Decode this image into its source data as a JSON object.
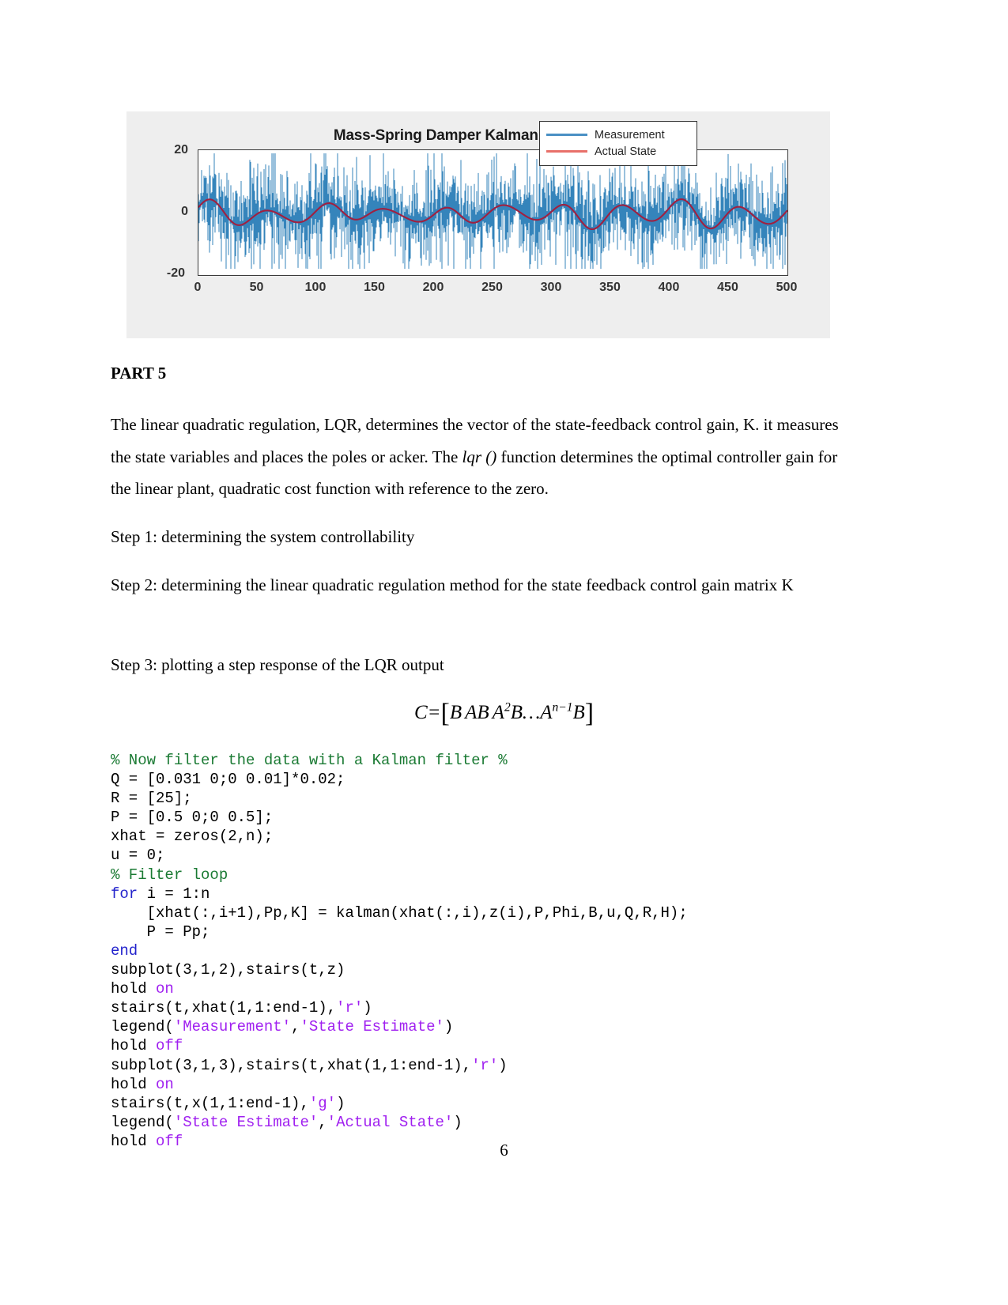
{
  "figure": {
    "title": "Mass-Spring Damper Kalman Filter Demo",
    "legend": [
      {
        "label": "Measurement",
        "color": "#4a90c4"
      },
      {
        "label": "Actual State",
        "color": "#e8706a"
      }
    ]
  },
  "chart_data": {
    "type": "line",
    "title": "Mass-Spring Damper Kalman Filter Demo",
    "xlabel": "",
    "ylabel": "",
    "xlim": [
      0,
      500
    ],
    "ylim": [
      -20,
      20
    ],
    "xticks": [
      0,
      50,
      100,
      150,
      200,
      250,
      300,
      350,
      400,
      450,
      500
    ],
    "yticks": [
      20,
      0,
      -20
    ],
    "grid": false,
    "legend_position": "upper-right",
    "series": [
      {
        "name": "Measurement",
        "color": "#1f77b4",
        "description": "Noisy measurement signal, dense high-frequency noise band roughly spanning -18 to +19 about the actual state",
        "noise_amplitude": 9.0,
        "peak_max": 19,
        "peak_min": -18
      },
      {
        "name": "Actual State",
        "color": "#a02040",
        "description": "Smooth oscillating true state of the mass-spring damper, amplitude about +/-4 with period near 50 samples",
        "amplitude": 4.0,
        "period": 50,
        "mean": -0.5
      }
    ]
  },
  "content": {
    "part_heading": "PART 5",
    "para1_a": "The linear quadratic regulation, LQR, determines the vector of the state-feedback control gain, K. it measures the state variables and places the poles or acker. The ",
    "para1_italic": "lqr ()",
    "para1_b": " function determines the optimal controller gain for the linear plant, quadratic cost function with reference to the zero.",
    "step1": "Step 1: determining the system controllability",
    "step2": "Step 2: determining the linear quadratic regulation method for the state feedback control gain matrix K",
    "step3": "Step 3: plotting a step response of the LQR output"
  },
  "formula": {
    "lhs": "C",
    "eq": "=",
    "open_bracket": "[",
    "term1": "B",
    "term2": "AB",
    "term3_base": "A",
    "term3_exp": "2",
    "term3_tail": "B",
    "ellipsis": "…",
    "term4_base": "A",
    "term4_exp": "n−1",
    "term4_tail": "B",
    "close_bracket": "]"
  },
  "code": {
    "lines": [
      {
        "segments": [
          {
            "t": "% Now filter the data with a Kalman filter %",
            "c": "cmt"
          }
        ]
      },
      {
        "segments": [
          {
            "t": "Q = [0.031 0;0 0.01]*0.02;",
            "c": ""
          }
        ]
      },
      {
        "segments": [
          {
            "t": "R = [25];",
            "c": ""
          }
        ]
      },
      {
        "segments": [
          {
            "t": "P = [0.5 0;0 0.5];",
            "c": ""
          }
        ]
      },
      {
        "segments": [
          {
            "t": "xhat = zeros(2,n);",
            "c": ""
          }
        ]
      },
      {
        "segments": [
          {
            "t": "u = 0;",
            "c": ""
          }
        ]
      },
      {
        "segments": [
          {
            "t": "% Filter loop",
            "c": "cmt"
          }
        ]
      },
      {
        "segments": [
          {
            "t": "for",
            "c": "kw"
          },
          {
            "t": " i = 1:n",
            "c": ""
          }
        ]
      },
      {
        "segments": [
          {
            "t": "    [xhat(:,i+1),Pp,K] = kalman(xhat(:,i),z(i),P,Phi,B,u,Q,R,H);",
            "c": ""
          }
        ]
      },
      {
        "segments": [
          {
            "t": "    P = Pp;",
            "c": ""
          }
        ]
      },
      {
        "segments": [
          {
            "t": "end",
            "c": "kw"
          }
        ]
      },
      {
        "segments": [
          {
            "t": "subplot(3,1,2),stairs(t,z)",
            "c": ""
          }
        ]
      },
      {
        "segments": [
          {
            "t": "hold ",
            "c": ""
          },
          {
            "t": "on",
            "c": "kw2"
          }
        ]
      },
      {
        "segments": [
          {
            "t": "stairs(t,xhat(1,1:end-1),",
            "c": ""
          },
          {
            "t": "'r'",
            "c": "str"
          },
          {
            "t": ")",
            "c": ""
          }
        ]
      },
      {
        "segments": [
          {
            "t": "legend(",
            "c": ""
          },
          {
            "t": "'Measurement'",
            "c": "str"
          },
          {
            "t": ",",
            "c": ""
          },
          {
            "t": "'State Estimate'",
            "c": "str"
          },
          {
            "t": ")",
            "c": ""
          }
        ]
      },
      {
        "segments": [
          {
            "t": "hold ",
            "c": ""
          },
          {
            "t": "off",
            "c": "kw2"
          }
        ]
      },
      {
        "segments": [
          {
            "t": "subplot(3,1,3),stairs(t,xhat(1,1:end-1),",
            "c": ""
          },
          {
            "t": "'r'",
            "c": "str"
          },
          {
            "t": ")",
            "c": ""
          }
        ]
      },
      {
        "segments": [
          {
            "t": "hold ",
            "c": ""
          },
          {
            "t": "on",
            "c": "kw2"
          }
        ]
      },
      {
        "segments": [
          {
            "t": "stairs(t,x(1,1:end-1),",
            "c": ""
          },
          {
            "t": "'g'",
            "c": "str"
          },
          {
            "t": ")",
            "c": ""
          }
        ]
      },
      {
        "segments": [
          {
            "t": "legend(",
            "c": ""
          },
          {
            "t": "'State Estimate'",
            "c": "str"
          },
          {
            "t": ",",
            "c": ""
          },
          {
            "t": "'Actual State'",
            "c": "str"
          },
          {
            "t": ")",
            "c": ""
          }
        ]
      },
      {
        "segments": [
          {
            "t": "hold ",
            "c": ""
          },
          {
            "t": "off",
            "c": "kw2"
          }
        ]
      }
    ]
  },
  "page_number": "6"
}
